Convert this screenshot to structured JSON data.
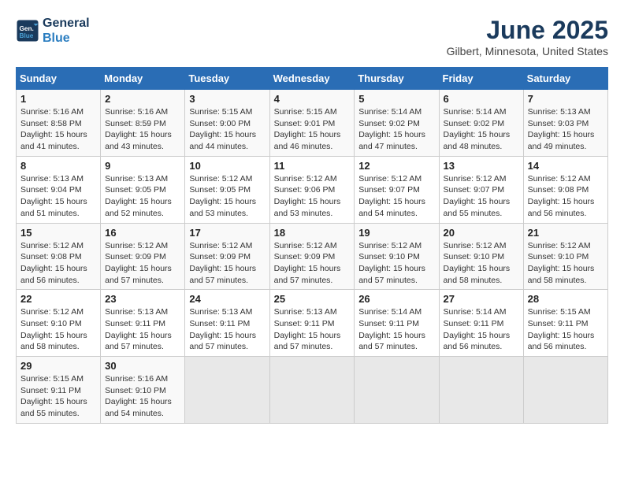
{
  "header": {
    "logo_line1": "General",
    "logo_line2": "Blue",
    "month": "June 2025",
    "location": "Gilbert, Minnesota, United States"
  },
  "weekdays": [
    "Sunday",
    "Monday",
    "Tuesday",
    "Wednesday",
    "Thursday",
    "Friday",
    "Saturday"
  ],
  "weeks": [
    [
      {
        "day": "1",
        "info": "Sunrise: 5:16 AM\nSunset: 8:58 PM\nDaylight: 15 hours\nand 41 minutes."
      },
      {
        "day": "2",
        "info": "Sunrise: 5:16 AM\nSunset: 8:59 PM\nDaylight: 15 hours\nand 43 minutes."
      },
      {
        "day": "3",
        "info": "Sunrise: 5:15 AM\nSunset: 9:00 PM\nDaylight: 15 hours\nand 44 minutes."
      },
      {
        "day": "4",
        "info": "Sunrise: 5:15 AM\nSunset: 9:01 PM\nDaylight: 15 hours\nand 46 minutes."
      },
      {
        "day": "5",
        "info": "Sunrise: 5:14 AM\nSunset: 9:02 PM\nDaylight: 15 hours\nand 47 minutes."
      },
      {
        "day": "6",
        "info": "Sunrise: 5:14 AM\nSunset: 9:02 PM\nDaylight: 15 hours\nand 48 minutes."
      },
      {
        "day": "7",
        "info": "Sunrise: 5:13 AM\nSunset: 9:03 PM\nDaylight: 15 hours\nand 49 minutes."
      }
    ],
    [
      {
        "day": "8",
        "info": "Sunrise: 5:13 AM\nSunset: 9:04 PM\nDaylight: 15 hours\nand 51 minutes."
      },
      {
        "day": "9",
        "info": "Sunrise: 5:13 AM\nSunset: 9:05 PM\nDaylight: 15 hours\nand 52 minutes."
      },
      {
        "day": "10",
        "info": "Sunrise: 5:12 AM\nSunset: 9:05 PM\nDaylight: 15 hours\nand 53 minutes."
      },
      {
        "day": "11",
        "info": "Sunrise: 5:12 AM\nSunset: 9:06 PM\nDaylight: 15 hours\nand 53 minutes."
      },
      {
        "day": "12",
        "info": "Sunrise: 5:12 AM\nSunset: 9:07 PM\nDaylight: 15 hours\nand 54 minutes."
      },
      {
        "day": "13",
        "info": "Sunrise: 5:12 AM\nSunset: 9:07 PM\nDaylight: 15 hours\nand 55 minutes."
      },
      {
        "day": "14",
        "info": "Sunrise: 5:12 AM\nSunset: 9:08 PM\nDaylight: 15 hours\nand 56 minutes."
      }
    ],
    [
      {
        "day": "15",
        "info": "Sunrise: 5:12 AM\nSunset: 9:08 PM\nDaylight: 15 hours\nand 56 minutes."
      },
      {
        "day": "16",
        "info": "Sunrise: 5:12 AM\nSunset: 9:09 PM\nDaylight: 15 hours\nand 57 minutes."
      },
      {
        "day": "17",
        "info": "Sunrise: 5:12 AM\nSunset: 9:09 PM\nDaylight: 15 hours\nand 57 minutes."
      },
      {
        "day": "18",
        "info": "Sunrise: 5:12 AM\nSunset: 9:09 PM\nDaylight: 15 hours\nand 57 minutes."
      },
      {
        "day": "19",
        "info": "Sunrise: 5:12 AM\nSunset: 9:10 PM\nDaylight: 15 hours\nand 57 minutes."
      },
      {
        "day": "20",
        "info": "Sunrise: 5:12 AM\nSunset: 9:10 PM\nDaylight: 15 hours\nand 58 minutes."
      },
      {
        "day": "21",
        "info": "Sunrise: 5:12 AM\nSunset: 9:10 PM\nDaylight: 15 hours\nand 58 minutes."
      }
    ],
    [
      {
        "day": "22",
        "info": "Sunrise: 5:12 AM\nSunset: 9:10 PM\nDaylight: 15 hours\nand 58 minutes."
      },
      {
        "day": "23",
        "info": "Sunrise: 5:13 AM\nSunset: 9:11 PM\nDaylight: 15 hours\nand 57 minutes."
      },
      {
        "day": "24",
        "info": "Sunrise: 5:13 AM\nSunset: 9:11 PM\nDaylight: 15 hours\nand 57 minutes."
      },
      {
        "day": "25",
        "info": "Sunrise: 5:13 AM\nSunset: 9:11 PM\nDaylight: 15 hours\nand 57 minutes."
      },
      {
        "day": "26",
        "info": "Sunrise: 5:14 AM\nSunset: 9:11 PM\nDaylight: 15 hours\nand 57 minutes."
      },
      {
        "day": "27",
        "info": "Sunrise: 5:14 AM\nSunset: 9:11 PM\nDaylight: 15 hours\nand 56 minutes."
      },
      {
        "day": "28",
        "info": "Sunrise: 5:15 AM\nSunset: 9:11 PM\nDaylight: 15 hours\nand 56 minutes."
      }
    ],
    [
      {
        "day": "29",
        "info": "Sunrise: 5:15 AM\nSunset: 9:11 PM\nDaylight: 15 hours\nand 55 minutes."
      },
      {
        "day": "30",
        "info": "Sunrise: 5:16 AM\nSunset: 9:10 PM\nDaylight: 15 hours\nand 54 minutes."
      },
      {
        "day": "",
        "info": ""
      },
      {
        "day": "",
        "info": ""
      },
      {
        "day": "",
        "info": ""
      },
      {
        "day": "",
        "info": ""
      },
      {
        "day": "",
        "info": ""
      }
    ]
  ]
}
